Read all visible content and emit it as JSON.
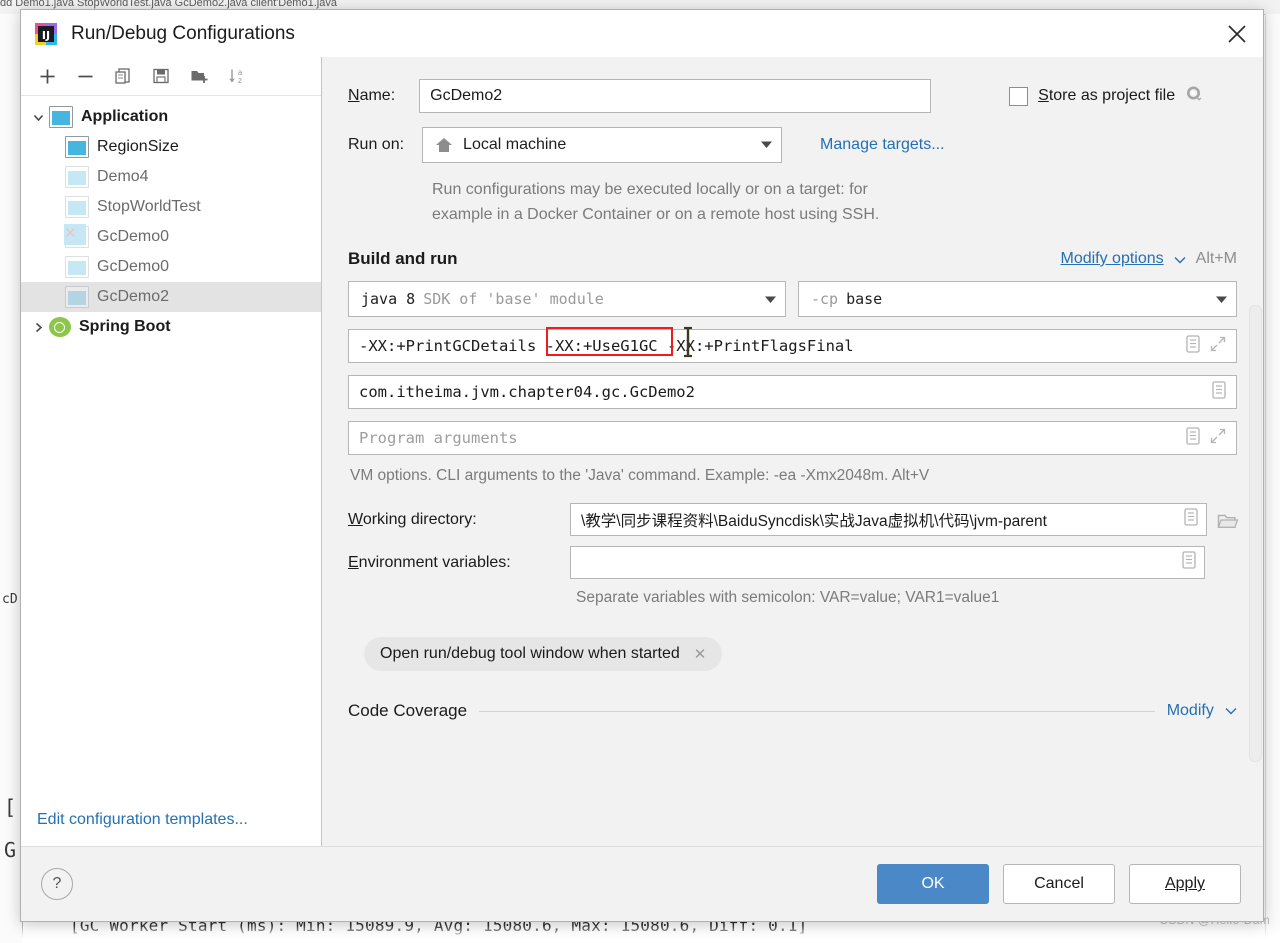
{
  "background": {
    "tabs": "dd  Demo1.java        StopWorldTest.java        GcDemo2.java        client'Demo1.java",
    "console_line": "[GC Worker Start (ms): Min: 15089.9, Avg: 15080.6, Max: 15080.6, Diff: 0.1]",
    "fragment_left_1": "cD",
    "fragment_left_2": "[",
    "fragment_left_3": "G",
    "watermark": "CSDN @Hello-Dam"
  },
  "window": {
    "title": "Run/Debug Configurations",
    "app_icon": "intellij-idea-icon",
    "close_icon": "close-icon"
  },
  "left_panel": {
    "toolbar": [
      {
        "name": "add-configuration-button",
        "icon": "plus-icon"
      },
      {
        "name": "remove-configuration-button",
        "icon": "minus-icon"
      },
      {
        "name": "copy-configuration-button",
        "icon": "copy-icon"
      },
      {
        "name": "save-configuration-button",
        "icon": "save-icon"
      },
      {
        "name": "new-folder-button",
        "icon": "folder-add-icon"
      },
      {
        "name": "sort-configurations-button",
        "icon": "sort-az-icon"
      }
    ],
    "tree": [
      {
        "label": "Application",
        "level": 0,
        "bold": true,
        "expanded": true,
        "icon": "application-icon",
        "selected": false
      },
      {
        "label": "RegionSize",
        "level": 1,
        "bold": false,
        "icon": "application-icon",
        "selected": false
      },
      {
        "label": "Demo4",
        "level": 1,
        "bold": false,
        "icon": "application-icon-pale",
        "selected": false
      },
      {
        "label": "StopWorldTest",
        "level": 1,
        "bold": false,
        "icon": "application-icon-pale",
        "selected": false
      },
      {
        "label": "GcDemo0",
        "level": 1,
        "bold": false,
        "icon": "application-icon-error",
        "selected": false
      },
      {
        "label": "GcDemo0",
        "level": 1,
        "bold": false,
        "icon": "application-icon-pale",
        "selected": false
      },
      {
        "label": "GcDemo2",
        "level": 1,
        "bold": false,
        "icon": "application-icon-pale",
        "selected": true
      },
      {
        "label": "Spring Boot",
        "level": 0,
        "bold": true,
        "expanded": false,
        "icon": "spring-boot-icon",
        "selected": false
      }
    ],
    "edit_templates_link": "Edit configuration templates..."
  },
  "form": {
    "name_label": "Name:",
    "name_value": "GcDemo2",
    "store_as_project_file_label": "Store as project file",
    "store_as_project_file_checked": false,
    "store_gear_icon": "gear-icon",
    "run_on_label": "Run on:",
    "run_on_value": "Local machine",
    "run_on_icon": "home-icon",
    "manage_targets_link": "Manage targets...",
    "description_line1": "Run configurations may be executed locally or on a target: for",
    "description_line2": "example in a Docker Container or on a remote host using SSH.",
    "build_and_run": {
      "title": "Build and run",
      "modify_options_link": "Modify options",
      "modify_options_shortcut": "Alt+M",
      "jdk_value_bold": "java 8",
      "jdk_value_dim": "SDK of 'base' module",
      "classpath_dim": "-cp",
      "classpath_value": "base",
      "vm_options_value": "-XX:+PrintGCDetails -XX:+UseG1GC -XX:+PrintFlagsFinal",
      "vm_options_part1": "-XX:+PrintGCDetails",
      "vm_options_highlighted": "-XX:+UseG1GC",
      "vm_options_part3": "-XX:+PrintFlagsFinal",
      "main_class_value": "com.itheima.jvm.chapter04.gc.GcDemo2",
      "program_arguments_placeholder": "Program arguments",
      "vm_hint": "VM options. CLI arguments to the 'Java' command. Example: -ea -Xmx2048m. Alt+V",
      "working_directory_label": "Working directory:",
      "working_directory_value": "\\教学\\同步课程资料\\BaiduSyncdisk\\实战Java虚拟机\\代码\\jvm-parent",
      "environment_variables_label": "Environment variables:",
      "environment_variables_value": "",
      "environment_hint": "Separate variables with semicolon: VAR=value; VAR1=value1",
      "chip_label": "Open run/debug tool window when started",
      "chip_close_icon": "close-icon"
    },
    "code_coverage": {
      "title": "Code Coverage",
      "modify_link": "Modify"
    }
  },
  "footer": {
    "help_icon": "help-icon",
    "ok_label": "OK",
    "cancel_label": "Cancel",
    "apply_label": "Apply"
  },
  "colors": {
    "accent_blue": "#4a88c7",
    "link_blue": "#2470b3",
    "highlight_red": "#ef1c1c",
    "dialog_bg": "#f2f2f2"
  }
}
